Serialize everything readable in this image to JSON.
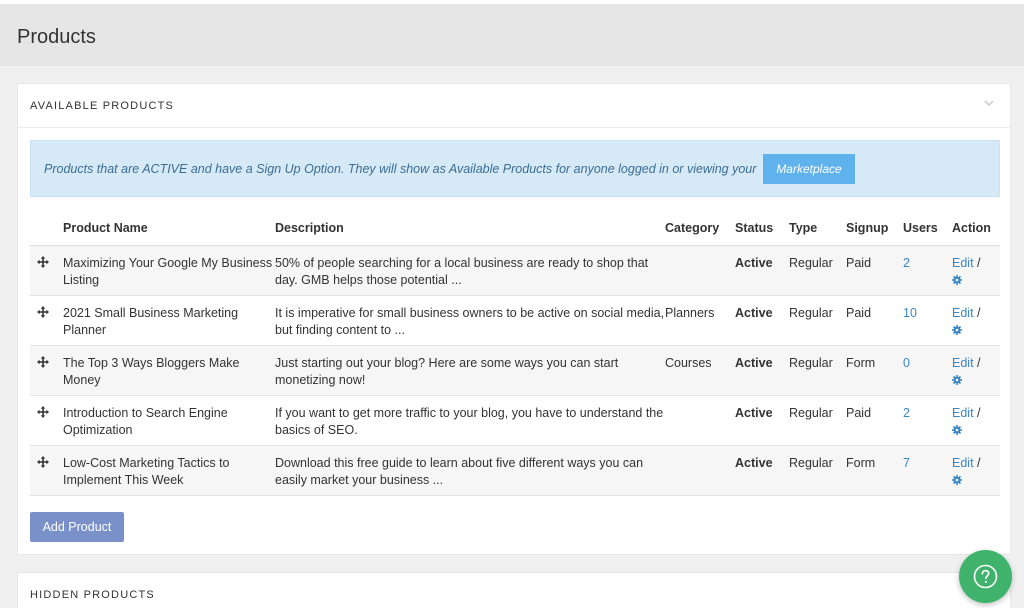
{
  "page": {
    "title": "Products"
  },
  "available": {
    "title": "AVAILABLE PRODUCTS",
    "banner_text": "Products that are ACTIVE and have a Sign Up Option. They will show as Available Products for anyone logged in or viewing your",
    "marketplace_label": "Marketplace",
    "columns": [
      "Product Name",
      "Description",
      "Category",
      "Status",
      "Type",
      "Signup",
      "Users",
      "Action"
    ],
    "rows": [
      {
        "name": "Maximizing Your Google My Business Listing",
        "description": "50% of people searching for a local business are ready to shop that day. GMB helps those potential ...",
        "category": "",
        "status": "Active",
        "type": "Regular",
        "signup": "Paid",
        "users": "2",
        "edit": "Edit",
        "sep": "/"
      },
      {
        "name": "2021 Small Business Marketing Planner",
        "description": "It is imperative for small business owners to be active on social media, but finding content to ...",
        "category": "Planners",
        "status": "Active",
        "type": "Regular",
        "signup": "Paid",
        "users": "10",
        "edit": "Edit",
        "sep": "/"
      },
      {
        "name": "The Top 3 Ways Bloggers Make Money",
        "description": "Just starting out your blog? Here are some ways you can start monetizing now!",
        "category": "Courses",
        "status": "Active",
        "type": "Regular",
        "signup": "Form",
        "users": "0",
        "edit": "Edit",
        "sep": "/"
      },
      {
        "name": "Introduction to Search Engine Optimization",
        "description": "If you want to get more traffic to your blog, you have to understand the basics of SEO.",
        "category": "",
        "status": "Active",
        "type": "Regular",
        "signup": "Paid",
        "users": "2",
        "edit": "Edit",
        "sep": "/"
      },
      {
        "name": "Low-Cost Marketing Tactics to Implement This Week",
        "description": "Download this free guide to learn about five different ways you can easily market your business ...",
        "category": "",
        "status": "Active",
        "type": "Regular",
        "signup": "Form",
        "users": "7",
        "edit": "Edit",
        "sep": "/"
      }
    ],
    "add_label": "Add Product"
  },
  "hidden": {
    "title": "HIDDEN PRODUCTS"
  },
  "icons": {
    "drag": "move-arrows-icon",
    "settings": "gear-icon",
    "collapse": "chevron-down-icon",
    "help": "help-circle-icon"
  },
  "colors": {
    "link": "#3b86c4",
    "banner_bg": "#d6e9f7",
    "add_button": "#7990c8",
    "help_fab": "#3fb36b"
  }
}
